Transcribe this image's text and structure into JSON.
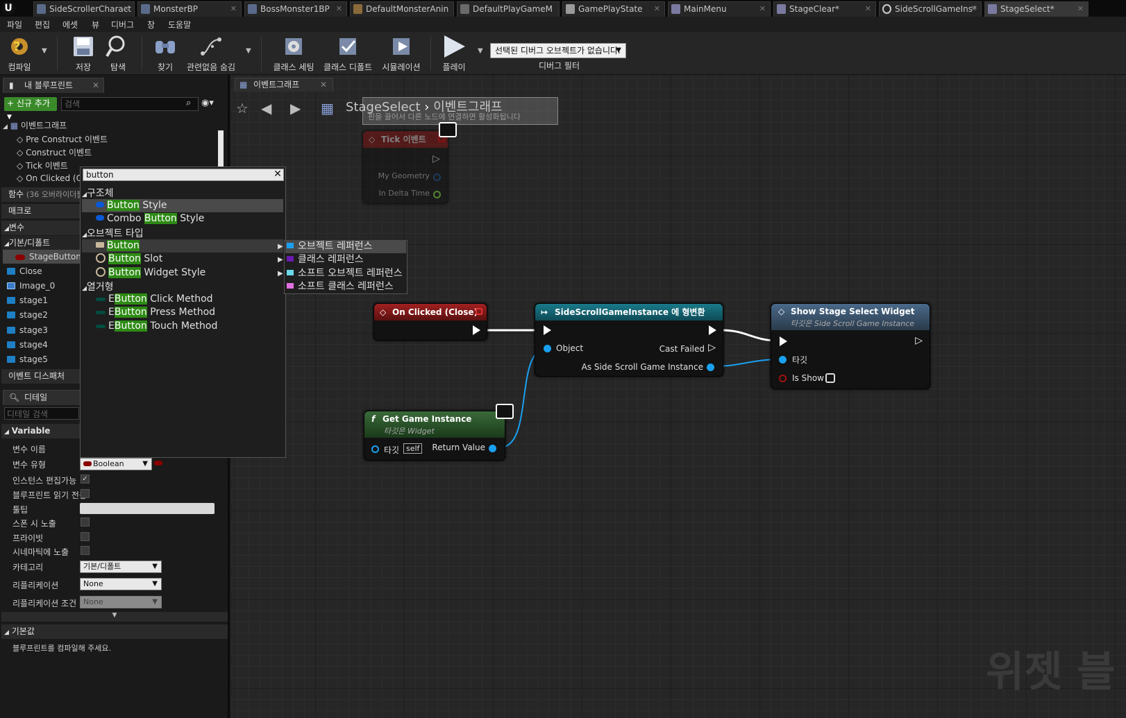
{
  "tabs": [
    "SideScrollerCharact",
    "MonsterBP",
    "BossMonster1BP",
    "DefaultMonsterAnin",
    "DefaultPlayGameM",
    "GamePlayState",
    "MainMenu",
    "StageClear*",
    "SideScrollGameIns*",
    "StageSelect*"
  ],
  "menu": [
    "파일",
    "편집",
    "에셋",
    "뷰",
    "디버그",
    "창",
    "도움말"
  ],
  "toolbar": {
    "compile": "컴파일",
    "save": "저장",
    "browse": "탐색",
    "find": "찾기",
    "hide_unrelated": "관련없음 숨김",
    "class_settings": "클래스 세팅",
    "class_defaults": "클래스 디폴트",
    "simulation": "시뮬레이션",
    "play": "플레이",
    "debug_select": "선택된 디버그 오브젝트가 없습니다.",
    "debug_filter": "디버그 필터"
  },
  "left": {
    "tab": "내 블루프린트",
    "add_new": "신규 추가",
    "search_placeholder": "검색",
    "event_graph": "이벤트그래프",
    "events": [
      "Pre Construct 이벤트",
      "Construct 이벤트",
      "Tick 이벤트",
      "On Clicked (C"
    ],
    "functions": "함수",
    "functions_override": "(36 오버라이더블",
    "macros": "매크로",
    "variables": "변수",
    "default_category": "기본/디폴트",
    "vars": [
      "StageButtonA",
      "Close",
      "Image_0",
      "stage1",
      "stage2",
      "stage3",
      "stage4",
      "stage5"
    ],
    "event_dispatchers": "이벤트 디스패처"
  },
  "details": {
    "tab": "디테일",
    "search_placeholder": "디테일 검색",
    "variable_section": "Variable",
    "labels": [
      "변수 이름",
      "변수 유형",
      "인스턴스 편집가능",
      "블루프린트 읽기 전용",
      "툴팁",
      "스폰 시 노출",
      "프라이빗",
      "시네마틱에 노출",
      "카테고리",
      "리플리케이션",
      "리플리케이션 조건"
    ],
    "var_type": "Boolean",
    "category": "기본/디폴트",
    "replication": "None",
    "replication_cond": "None",
    "default_section": "기본값",
    "compile_msg": "블루프린트를 컴파일해 주세요."
  },
  "graph": {
    "tab": "이벤트그래프",
    "breadcrumb_bp": "StageSelect",
    "breadcrumb_graph": "이벤트그래프",
    "hint": "핀을 끌어서 다른 노드에 연결하면 활성화됩니다",
    "watermark": "위젯 블"
  },
  "nodes": {
    "tick": {
      "title": "Tick 이벤트",
      "pins": [
        "My Geometry",
        "In Delta Time"
      ]
    },
    "onclicked": {
      "title": "On Clicked (Close)"
    },
    "cast": {
      "title": "SideScrollGameInstance 에 형변환",
      "object": "Object",
      "cast_failed": "Cast Failed",
      "as_out": "As Side Scroll Game Instance"
    },
    "getgi": {
      "title": "Get Game Instance",
      "subtitle": "타깃은 Widget",
      "target": "타깃",
      "self": "self",
      "ret": "Return Value"
    },
    "show": {
      "title": "Show Stage Select Widget",
      "subtitle": "타깃은 Side Scroll Game Instance",
      "target": "타깃",
      "isshow": "Is Show"
    }
  },
  "context_menu": {
    "query": "button",
    "categories": [
      "구조체",
      "오브젝트 타입",
      "열거형"
    ],
    "struct_items": [
      {
        "pre": "",
        "hl": "Button",
        "post": " Style"
      },
      {
        "pre": "Combo ",
        "hl": "Button",
        "post": " Style"
      }
    ],
    "object_items": [
      {
        "pre": "",
        "hl": "Button",
        "post": ""
      },
      {
        "pre": "",
        "hl": "Button",
        "post": " Slot"
      },
      {
        "pre": "",
        "hl": "Button",
        "post": " Widget Style"
      }
    ],
    "enum_items": [
      {
        "pre": "E",
        "hl": "Button",
        "post": " Click Method"
      },
      {
        "pre": "E",
        "hl": "Button",
        "post": " Press Method"
      },
      {
        "pre": "E",
        "hl": "Button",
        "post": " Touch Method"
      }
    ],
    "submenu": [
      "오브젝트 레퍼런스",
      "클래스 레퍼런스",
      "소프트 오브젝트 레퍼런스",
      "소프트 클래스 레퍼런스"
    ]
  },
  "colors": {
    "struct": "#0a5ad8",
    "object": "#1aa0f0",
    "class": "#6a1ab0",
    "soft_obj": "#6ad8e8",
    "soft_class": "#e070e0",
    "bool": "#8a0000",
    "enum": "#004d40"
  }
}
